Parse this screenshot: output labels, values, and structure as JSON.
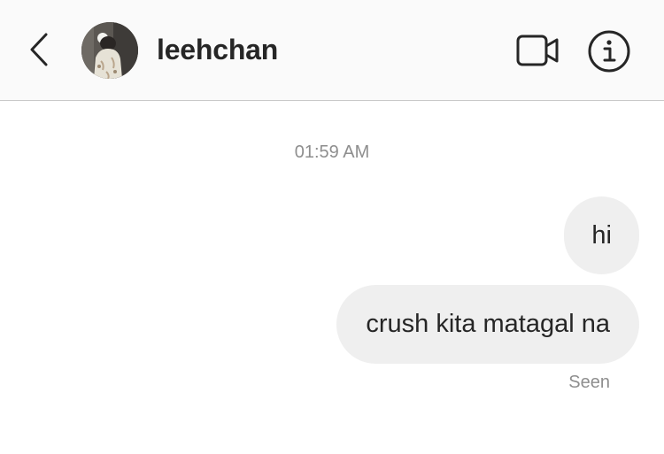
{
  "header": {
    "back_icon": "chevron-left-icon",
    "username": "leehchan",
    "video_icon": "video-camera-icon",
    "info_icon": "info-circle-icon"
  },
  "thread": {
    "timestamp": "01:59 AM",
    "messages": [
      {
        "text": "hi",
        "sender": "me"
      },
      {
        "text": "crush kita matagal na",
        "sender": "me"
      }
    ],
    "status": "Seen"
  },
  "colors": {
    "header_bg": "#fafafa",
    "bubble_bg": "#efefef",
    "text": "#262626",
    "muted": "#8e8e8e",
    "divider": "#c8c8c8"
  }
}
